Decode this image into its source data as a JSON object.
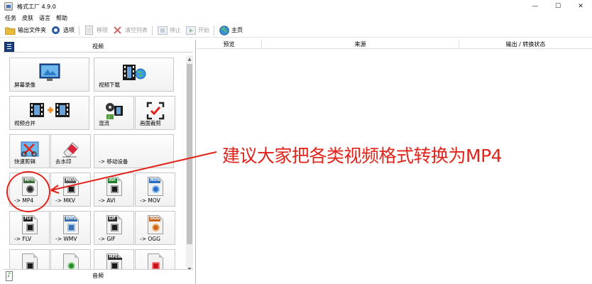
{
  "window": {
    "title": "格式工厂 4.9.0",
    "controls": [
      "—",
      "☐",
      "✕"
    ]
  },
  "menu": [
    "任务",
    "皮肤",
    "语言",
    "帮助"
  ],
  "toolbar": {
    "output_folder": "输出文件夹",
    "options": "选项",
    "remove": "移除",
    "clear_list": "清空列表",
    "stop": "停止",
    "start": "开始",
    "home": "主页"
  },
  "left_panel": {
    "header": "视频",
    "footer": "音频",
    "tiles": {
      "screen_record": "屏幕录像",
      "video_download": "视频下载",
      "video_merge": "视频合并",
      "mix": "混流",
      "crop": "画面裁剪",
      "quick_edit": "快速剪辑",
      "watermark": "去水印",
      "mobile": "-> 移动设备",
      "mp4": "-> MP4",
      "mkv": "-> MKV",
      "avi": "-> AVI",
      "mov": "-> MOV",
      "flv": "-> FLV",
      "wmv": "-> WMV",
      "gif": "-> GIF",
      "ogg": "-> OGG"
    },
    "badges": {
      "mp4": "MP4",
      "mkv": "MKV",
      "avi": "AVI",
      "mov": "MOV",
      "flv": "FLV",
      "wmv": "WMV",
      "gif": "GIF",
      "ogg": "OGG",
      "mpeg": "MPEG"
    }
  },
  "task_table": {
    "columns": [
      "预览",
      "来源",
      "输出 / 转换状态"
    ]
  },
  "annotation": "建议大家把各类视频格式转换为MP4",
  "colors": {
    "annotation": "#e2231a",
    "badge_mp4": "#3c6e3c",
    "badge_mkv": "#555555",
    "badge_avi": "#1f7f2a",
    "badge_mov": "#2b6cc4",
    "badge_flv": "#222222",
    "badge_wmv": "#3a6fb0",
    "badge_gif": "#333333",
    "badge_ogg": "#c8651b"
  }
}
